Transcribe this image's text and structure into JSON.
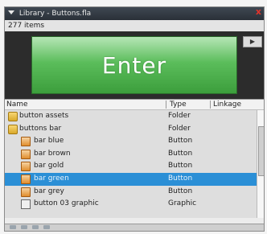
{
  "window": {
    "title": "Library - Buttons.fla",
    "close_glyph": "x",
    "menu_glyph": "☰"
  },
  "library": {
    "item_count": "277 items",
    "preview": {
      "button_text": "Enter",
      "play_glyph": "▶"
    },
    "columns": {
      "name": "Name",
      "type": "Type",
      "linkage": "Linkage"
    },
    "rows": [
      {
        "icon": "folder-icon",
        "name": "button assets",
        "type": "Folder",
        "indent": 0
      },
      {
        "icon": "folder-icon",
        "name": "buttons bar",
        "type": "Folder",
        "indent": 0
      },
      {
        "icon": "button-icon",
        "name": "bar blue",
        "type": "Button",
        "indent": 1
      },
      {
        "icon": "button-icon",
        "name": "bar brown",
        "type": "Button",
        "indent": 1
      },
      {
        "icon": "button-icon",
        "name": "bar gold",
        "type": "Button",
        "indent": 1
      },
      {
        "icon": "button-icon",
        "name": "bar green",
        "type": "Button",
        "indent": 1,
        "selected": true
      },
      {
        "icon": "button-icon",
        "name": "bar grey",
        "type": "Button",
        "indent": 1
      },
      {
        "icon": "graphic-icon",
        "name": "button 03 graphic",
        "type": "Graphic",
        "indent": 1
      }
    ]
  },
  "colors": {
    "selection": "#2b8fd6",
    "preview_button": "#4caf50",
    "titlebar": "#333a42"
  }
}
